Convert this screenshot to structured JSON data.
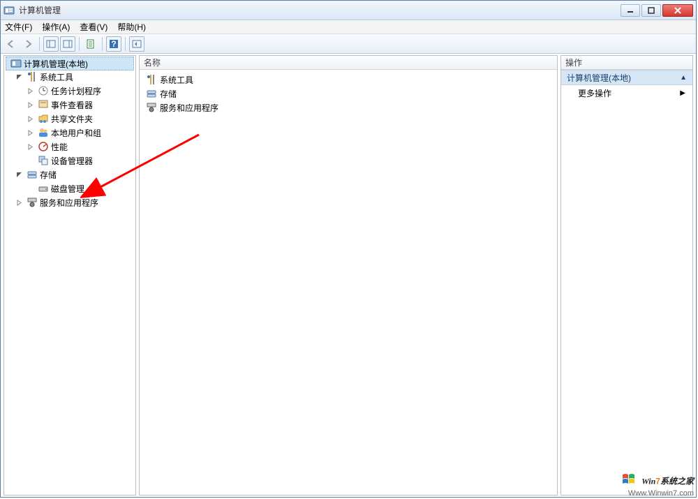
{
  "titlebar": {
    "title": "计算机管理"
  },
  "menubar": {
    "file": "文件(F)",
    "action": "操作(A)",
    "view": "查看(V)",
    "help": "帮助(H)"
  },
  "tree": {
    "root": "计算机管理(本地)",
    "systemTools": "系统工具",
    "taskScheduler": "任务计划程序",
    "eventViewer": "事件查看器",
    "sharedFolders": "共享文件夹",
    "localUsersGroups": "本地用户和组",
    "performance": "性能",
    "deviceManager": "设备管理器",
    "storage": "存储",
    "diskManagement": "磁盘管理",
    "servicesApps": "服务和应用程序"
  },
  "list": {
    "header": "名称",
    "item1": "系统工具",
    "item2": "存储",
    "item3": "服务和应用程序"
  },
  "actions": {
    "header": "操作",
    "group": "计算机管理(本地)",
    "more": "更多操作"
  },
  "watermark": {
    "brand_left": "Win",
    "brand_num": "7",
    "brand_right": "系统之家",
    "url": "Www.Winwin7.com"
  }
}
